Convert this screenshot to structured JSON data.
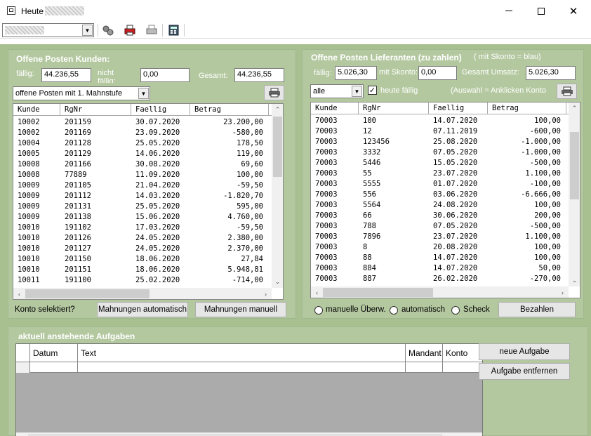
{
  "window": {
    "title": "Heute"
  },
  "toolbar": {
    "combo_value": ""
  },
  "customers": {
    "heading": "Offene Posten Kunden:",
    "faellig_label": "fällig:",
    "faellig_value": "44.236,55",
    "nicht_label": "nicht fällig:",
    "nicht_value": "0,00",
    "gesamt_label": "Gesamt:",
    "gesamt_value": "44.236,55",
    "filter_value": "offene Posten mit 1. Mahnstufe",
    "columns": [
      "Kunde",
      "RgNr",
      "Faellig",
      "Betrag"
    ],
    "rows": [
      [
        "10002",
        "201159",
        "30.07.2020",
        "23.200,00"
      ],
      [
        "10002",
        "201169",
        "23.09.2020",
        "-580,00"
      ],
      [
        "10004",
        "201128",
        "25.05.2020",
        "178,50"
      ],
      [
        "10005",
        "201129",
        "14.06.2020",
        "119,00"
      ],
      [
        "10008",
        "201166",
        "30.08.2020",
        "69,60"
      ],
      [
        "10008",
        "77889",
        "11.09.2020",
        "100,00"
      ],
      [
        "10009",
        "201105",
        "21.04.2020",
        "-59,50"
      ],
      [
        "10009",
        "201112",
        "14.03.2020",
        "-1.820,70"
      ],
      [
        "10009",
        "201131",
        "25.05.2020",
        "595,00"
      ],
      [
        "10009",
        "201138",
        "15.06.2020",
        "4.760,00"
      ],
      [
        "10010",
        "191102",
        "17.03.2020",
        "-59,50"
      ],
      [
        "10010",
        "201126",
        "24.05.2020",
        "2.380,00"
      ],
      [
        "10010",
        "201127",
        "24.05.2020",
        "2.370,00"
      ],
      [
        "10010",
        "201150",
        "18.06.2020",
        "27,84"
      ],
      [
        "10010",
        "201151",
        "18.06.2020",
        "5.948,81"
      ],
      [
        "10011",
        "191100",
        "25.02.2020",
        "-714,00"
      ]
    ],
    "konto_label": "Konto selektiert?",
    "btn_auto": "Mahnungen automatisch",
    "btn_manual": "Mahnungen manuell"
  },
  "suppliers": {
    "heading": "Offene Posten Lieferanten (zu zahlen)",
    "skonto_note": "( mit Skonto = blau)",
    "faellig_label": "fällig:",
    "faellig_value": "5.026,30",
    "skonto_label": "mit Skonto:",
    "skonto_value": "0,00",
    "umsatz_label": "Gesamt Umsatz:",
    "umsatz_value": "5.026,30",
    "filter_value": "alle",
    "heute_label": "heute fällig",
    "auswahl_note": "(Auswahl = Anklicken Konto",
    "columns": [
      "Kunde",
      "RgNr",
      "Faellig",
      "Betrag"
    ],
    "rows": [
      [
        "70003",
        "100",
        "14.07.2020",
        "100,00"
      ],
      [
        "70003",
        "12",
        "07.11.2019",
        "-600,00"
      ],
      [
        "70003",
        "123456",
        "25.08.2020",
        "-1.000,00"
      ],
      [
        "70003",
        "3332",
        "07.05.2020",
        "-1.000,00"
      ],
      [
        "70003",
        "5446",
        "15.05.2020",
        "-500,00"
      ],
      [
        "70003",
        "55",
        "23.07.2020",
        "1.100,00"
      ],
      [
        "70003",
        "5555",
        "01.07.2020",
        "-100,00"
      ],
      [
        "70003",
        "556",
        "03.06.2020",
        "-6.666,00"
      ],
      [
        "70003",
        "5564",
        "24.08.2020",
        "100,00"
      ],
      [
        "70003",
        "66",
        "30.06.2020",
        "200,00"
      ],
      [
        "70003",
        "788",
        "07.05.2020",
        "-500,00"
      ],
      [
        "70003",
        "7896",
        "23.07.2020",
        "1.100,00"
      ],
      [
        "70003",
        "8",
        "20.08.2020",
        "100,00"
      ],
      [
        "70003",
        "88",
        "14.07.2020",
        "100,00"
      ],
      [
        "70003",
        "884",
        "14.07.2020",
        "50,00"
      ],
      [
        "70003",
        "887",
        "26.02.2020",
        "-270,00"
      ]
    ],
    "radio_manual": "manuelle Überw.",
    "radio_auto": "automatisch",
    "radio_scheck": "Scheck",
    "btn_pay": "Bezahlen"
  },
  "tasks": {
    "heading": "aktuell anstehende Aufgaben",
    "columns": [
      "Datum",
      "Text",
      "Mandant",
      "Konto"
    ],
    "btn_new": "neue Aufgabe",
    "btn_remove": "Aufgabe entfernen"
  },
  "colors": {
    "panel_green": "#b4c8a0",
    "outer_green": "#a8c090"
  }
}
